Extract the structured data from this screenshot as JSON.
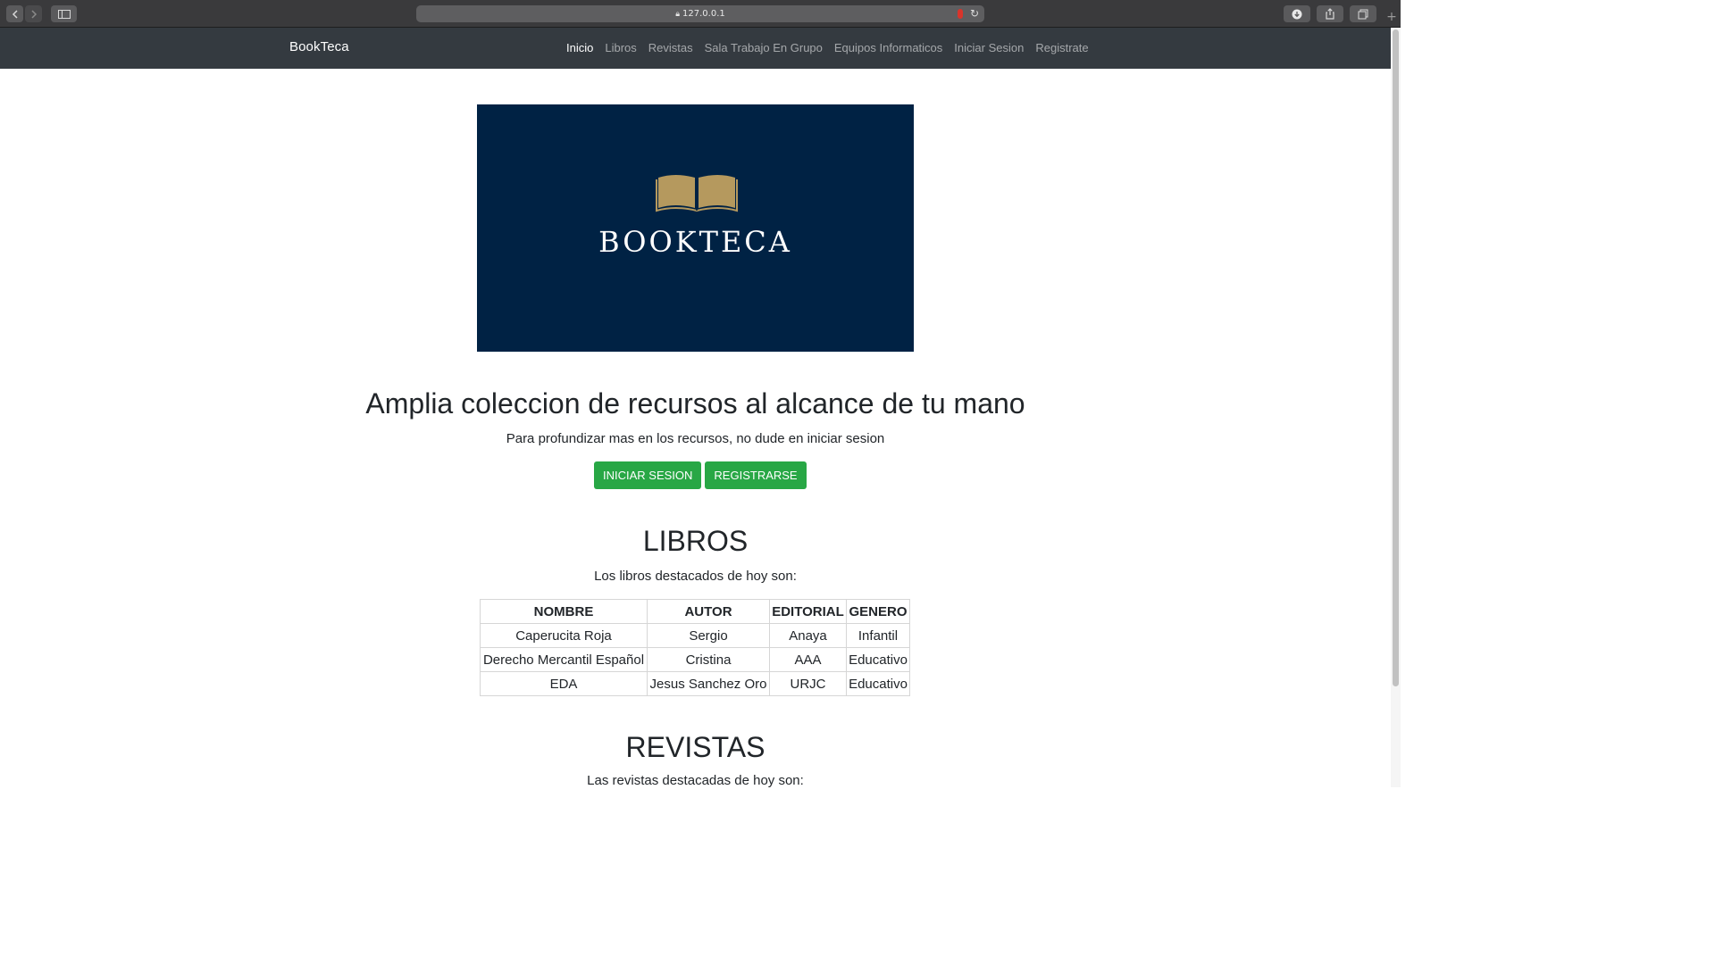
{
  "browser": {
    "url": "127.0.0.1",
    "lock_icon": "lock-icon",
    "accent": "#3a3a3c"
  },
  "navbar": {
    "brand": "BookTeca",
    "links": [
      "Inicio",
      "Libros",
      "Revistas",
      "Sala Trabajo En Grupo",
      "Equipos Informaticos",
      "Iniciar Sesion",
      "Registrate"
    ],
    "active_index": 0,
    "bg_color": "#343a40"
  },
  "banner": {
    "logo_text": "BOOKTECA",
    "bg_color": "#002244",
    "icon": "open-book-icon",
    "icon_color": "#b5995e"
  },
  "hero": {
    "title": "Amplia coleccion de recursos al alcance de tu mano",
    "subtitle": "Para profundizar mas en los recursos, no dude en iniciar sesion",
    "login_button": "INICIAR SESION",
    "register_button": "REGISTRARSE",
    "button_color": "#28a745"
  },
  "libros": {
    "title": "LIBROS",
    "subtitle": "Los libros destacados de hoy son:",
    "columns": [
      "NOMBRE",
      "AUTOR",
      "EDITORIAL",
      "GENERO"
    ],
    "rows": [
      [
        "Caperucita Roja",
        "Sergio",
        "Anaya",
        "Infantil"
      ],
      [
        "Derecho Mercantil Español",
        "Cristina",
        "AAA",
        "Educativo"
      ],
      [
        "EDA",
        "Jesus Sanchez Oro",
        "URJC",
        "Educativo"
      ]
    ]
  },
  "revistas": {
    "title": "REVISTAS",
    "subtitle": "Las revistas destacadas de hoy son:"
  }
}
